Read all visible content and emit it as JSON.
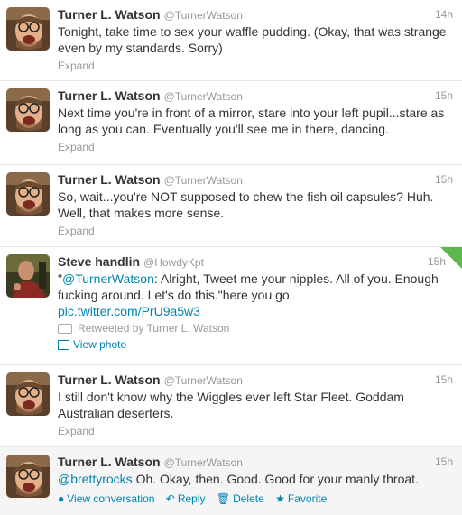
{
  "tweets": [
    {
      "name": "Turner L. Watson",
      "handle": "@TurnerWatson",
      "time": "14h",
      "text": "Tonight, take time to sex your waffle pudding. (Okay, that was strange even by my standards. Sorry)",
      "expand": "Expand"
    },
    {
      "name": "Turner L. Watson",
      "handle": "@TurnerWatson",
      "time": "15h",
      "text": "Next time you're in front of a mirror, stare into your left pupil...stare as long as you can. Eventually you'll see me in there, dancing.",
      "expand": "Expand"
    },
    {
      "name": "Turner L. Watson",
      "handle": "@TurnerWatson",
      "time": "15h",
      "text": "So, wait...you're NOT supposed to chew the fish oil capsules? Huh. Well, that makes more sense.",
      "expand": "Expand"
    },
    {
      "name": "Steve handlin",
      "handle": "@HowdyKpt",
      "time": "15h",
      "text_quote_open": "\"",
      "text_mention": "@TurnerWatson",
      "text_rest": ": Alright, Tweet me your nipples. All of you. Enough fucking around. Let's do this.\"here you go",
      "link": "pic.twitter.com/PrU9a5w3",
      "retweeted_by": "Retweeted by Turner L. Watson",
      "view_photo": "View photo"
    },
    {
      "name": "Turner L. Watson",
      "handle": "@TurnerWatson",
      "time": "15h",
      "text": "I still don't know why the Wiggles ever left Star Fleet. Goddam Australian deserters.",
      "expand": "Expand"
    },
    {
      "name": "Turner L. Watson",
      "handle": "@TurnerWatson",
      "time": "15h",
      "text_mention": "@brettyrocks",
      "text_rest": " Oh. Okay, then. Good. Good for your manly throat.",
      "actions": {
        "view_conversation": "View conversation",
        "reply": "Reply",
        "delete": "Delete",
        "favorite": "Favorite"
      }
    }
  ],
  "colors": {
    "link": "#0084b4",
    "muted": "#999999",
    "text": "#333333",
    "corner_badge": "#5db84c"
  }
}
